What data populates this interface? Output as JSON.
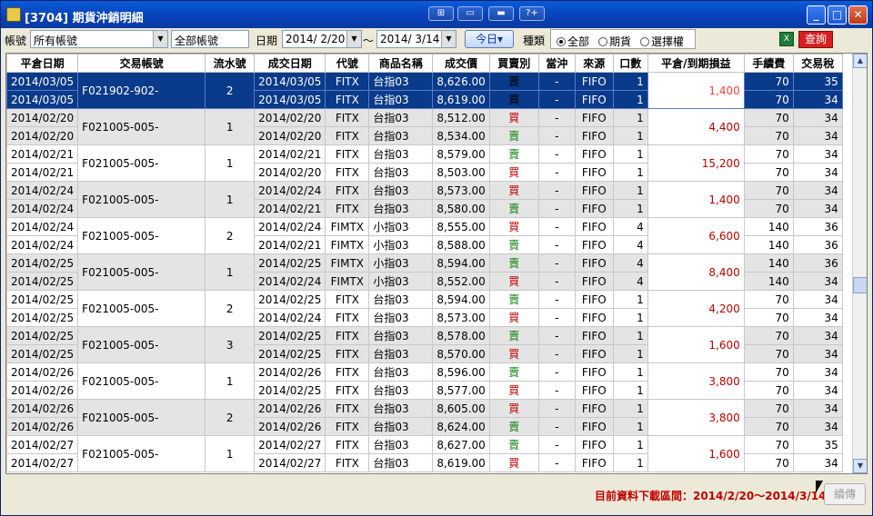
{
  "window": {
    "title": "[3704] 期貨沖銷明細",
    "min": "_",
    "max": "□",
    "close": "✕"
  },
  "toolbar_icons": [
    "⊞",
    "▭",
    "▬",
    "?+"
  ],
  "filters": {
    "account_label": "帳號",
    "account_value": "所有帳號",
    "account_field": "全部帳號",
    "date_label": "日期",
    "date_from": "2014/ 2/20",
    "tilde": "～",
    "date_to": "2014/ 3/14",
    "today_btn": "今日▾",
    "type_label": "種類",
    "radio_all": "全部",
    "radio_futures": "期貨",
    "radio_options": "選擇權",
    "excel_icon": "X",
    "query_btn": "查詢"
  },
  "columns": [
    "平倉日期",
    "交易帳號",
    "流水號",
    "成交日期",
    "代號",
    "商品名稱",
    "成交價",
    "買賣別",
    "當沖",
    "來源",
    "口數",
    "平倉/到期損益",
    "手續費",
    "交易稅"
  ],
  "groups": [
    {
      "acct": "F021902-902-",
      "serial": "2",
      "pl": "1,400",
      "rows": [
        {
          "close": "2014/03/05",
          "trade": "2014/03/05",
          "code": "FITX",
          "name": "台指03",
          "price": "8,626.00",
          "side": "賣",
          "dc": "-",
          "src": "FIFO",
          "qty": "1",
          "fee": "70",
          "tax": "35"
        },
        {
          "close": "2014/03/05",
          "trade": "2014/03/05",
          "code": "FITX",
          "name": "台指03",
          "price": "8,619.00",
          "side": "買",
          "dc": "-",
          "src": "FIFO",
          "qty": "1",
          "fee": "70",
          "tax": "34"
        }
      ]
    },
    {
      "acct": "F021005-005-",
      "serial": "1",
      "pl": "4,400",
      "rows": [
        {
          "close": "2014/02/20",
          "trade": "2014/02/20",
          "code": "FITX",
          "name": "台指03",
          "price": "8,512.00",
          "side": "買",
          "dc": "-",
          "src": "FIFO",
          "qty": "1",
          "fee": "70",
          "tax": "34"
        },
        {
          "close": "2014/02/20",
          "trade": "2014/02/20",
          "code": "FITX",
          "name": "台指03",
          "price": "8,534.00",
          "side": "賣",
          "dc": "-",
          "src": "FIFO",
          "qty": "1",
          "fee": "70",
          "tax": "34"
        }
      ]
    },
    {
      "acct": "F021005-005-",
      "serial": "1",
      "pl": "15,200",
      "rows": [
        {
          "close": "2014/02/21",
          "trade": "2014/02/21",
          "code": "FITX",
          "name": "台指03",
          "price": "8,579.00",
          "side": "賣",
          "dc": "-",
          "src": "FIFO",
          "qty": "1",
          "fee": "70",
          "tax": "34"
        },
        {
          "close": "2014/02/21",
          "trade": "2014/02/20",
          "code": "FITX",
          "name": "台指03",
          "price": "8,503.00",
          "side": "買",
          "dc": "-",
          "src": "FIFO",
          "qty": "1",
          "fee": "70",
          "tax": "34"
        }
      ]
    },
    {
      "acct": "F021005-005-",
      "serial": "1",
      "pl": "1,400",
      "rows": [
        {
          "close": "2014/02/24",
          "trade": "2014/02/24",
          "code": "FITX",
          "name": "台指03",
          "price": "8,573.00",
          "side": "買",
          "dc": "-",
          "src": "FIFO",
          "qty": "1",
          "fee": "70",
          "tax": "34"
        },
        {
          "close": "2014/02/24",
          "trade": "2014/02/21",
          "code": "FITX",
          "name": "台指03",
          "price": "8,580.00",
          "side": "賣",
          "dc": "-",
          "src": "FIFO",
          "qty": "1",
          "fee": "70",
          "tax": "34"
        }
      ]
    },
    {
      "acct": "F021005-005-",
      "serial": "2",
      "pl": "6,600",
      "rows": [
        {
          "close": "2014/02/24",
          "trade": "2014/02/24",
          "code": "FIMTX",
          "name": "小指03",
          "price": "8,555.00",
          "side": "買",
          "dc": "-",
          "src": "FIFO",
          "qty": "4",
          "fee": "140",
          "tax": "36"
        },
        {
          "close": "2014/02/24",
          "trade": "2014/02/21",
          "code": "FIMTX",
          "name": "小指03",
          "price": "8,588.00",
          "side": "賣",
          "dc": "-",
          "src": "FIFO",
          "qty": "4",
          "fee": "140",
          "tax": "36"
        }
      ]
    },
    {
      "acct": "F021005-005-",
      "serial": "1",
      "pl": "8,400",
      "rows": [
        {
          "close": "2014/02/25",
          "trade": "2014/02/25",
          "code": "FIMTX",
          "name": "小指03",
          "price": "8,594.00",
          "side": "賣",
          "dc": "-",
          "src": "FIFO",
          "qty": "4",
          "fee": "140",
          "tax": "36"
        },
        {
          "close": "2014/02/25",
          "trade": "2014/02/24",
          "code": "FIMTX",
          "name": "小指03",
          "price": "8,552.00",
          "side": "買",
          "dc": "-",
          "src": "FIFO",
          "qty": "4",
          "fee": "140",
          "tax": "34"
        }
      ]
    },
    {
      "acct": "F021005-005-",
      "serial": "2",
      "pl": "4,200",
      "rows": [
        {
          "close": "2014/02/25",
          "trade": "2014/02/25",
          "code": "FITX",
          "name": "台指03",
          "price": "8,594.00",
          "side": "賣",
          "dc": "-",
          "src": "FIFO",
          "qty": "1",
          "fee": "70",
          "tax": "34"
        },
        {
          "close": "2014/02/25",
          "trade": "2014/02/24",
          "code": "FITX",
          "name": "台指03",
          "price": "8,573.00",
          "side": "買",
          "dc": "-",
          "src": "FIFO",
          "qty": "1",
          "fee": "70",
          "tax": "34"
        }
      ]
    },
    {
      "acct": "F021005-005-",
      "serial": "3",
      "pl": "1,600",
      "rows": [
        {
          "close": "2014/02/25",
          "trade": "2014/02/25",
          "code": "FITX",
          "name": "台指03",
          "price": "8,578.00",
          "side": "賣",
          "dc": "-",
          "src": "FIFO",
          "qty": "1",
          "fee": "70",
          "tax": "34"
        },
        {
          "close": "2014/02/25",
          "trade": "2014/02/25",
          "code": "FITX",
          "name": "台指03",
          "price": "8,570.00",
          "side": "買",
          "dc": "-",
          "src": "FIFO",
          "qty": "1",
          "fee": "70",
          "tax": "34"
        }
      ]
    },
    {
      "acct": "F021005-005-",
      "serial": "1",
      "pl": "3,800",
      "rows": [
        {
          "close": "2014/02/26",
          "trade": "2014/02/26",
          "code": "FITX",
          "name": "台指03",
          "price": "8,596.00",
          "side": "賣",
          "dc": "-",
          "src": "FIFO",
          "qty": "1",
          "fee": "70",
          "tax": "34"
        },
        {
          "close": "2014/02/26",
          "trade": "2014/02/25",
          "code": "FITX",
          "name": "台指03",
          "price": "8,577.00",
          "side": "買",
          "dc": "-",
          "src": "FIFO",
          "qty": "1",
          "fee": "70",
          "tax": "34"
        }
      ]
    },
    {
      "acct": "F021005-005-",
      "serial": "2",
      "pl": "3,800",
      "rows": [
        {
          "close": "2014/02/26",
          "trade": "2014/02/26",
          "code": "FITX",
          "name": "台指03",
          "price": "8,605.00",
          "side": "買",
          "dc": "-",
          "src": "FIFO",
          "qty": "1",
          "fee": "70",
          "tax": "34"
        },
        {
          "close": "2014/02/26",
          "trade": "2014/02/26",
          "code": "FITX",
          "name": "台指03",
          "price": "8,624.00",
          "side": "賣",
          "dc": "-",
          "src": "FIFO",
          "qty": "1",
          "fee": "70",
          "tax": "34"
        }
      ]
    },
    {
      "acct": "F021005-005-",
      "serial": "1",
      "pl": "1,600",
      "rows": [
        {
          "close": "2014/02/27",
          "trade": "2014/02/27",
          "code": "FITX",
          "name": "台指03",
          "price": "8,627.00",
          "side": "賣",
          "dc": "-",
          "src": "FIFO",
          "qty": "1",
          "fee": "70",
          "tax": "35"
        },
        {
          "close": "2014/02/27",
          "trade": "2014/02/27",
          "code": "FITX",
          "name": "台指03",
          "price": "8,619.00",
          "side": "買",
          "dc": "-",
          "src": "FIFO",
          "qty": "1",
          "fee": "70",
          "tax": "34"
        }
      ]
    }
  ],
  "status": {
    "range_text": "目前資料下載區間：2014/2/20～2014/3/14",
    "continue_btn": "續傳"
  },
  "colors": {
    "title_bar": "#0741b8",
    "selected_row": "#0a3a8a",
    "profit": "#c00000",
    "sell": "#108010",
    "buy": "#c00000"
  }
}
